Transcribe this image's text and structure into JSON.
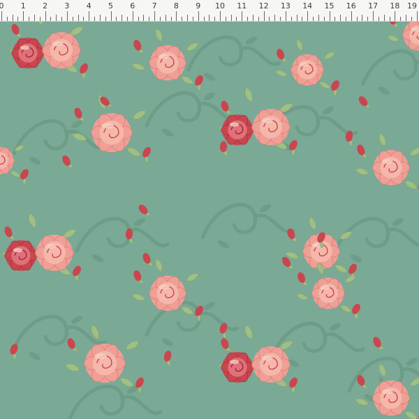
{
  "colors": {
    "fabric_background": "#7aa996",
    "swirl": "#6b9a86",
    "rose_dark": "#c9464f",
    "rose_light": "#ef9f95",
    "rose_highlight": "#f8cfc2",
    "leaf": "#9ebf86",
    "ruler_bg": "#f6f6f4"
  },
  "ruler": {
    "unit_labels": [
      "0",
      "1",
      "2",
      "3",
      "4",
      "5",
      "6",
      "7",
      "8",
      "9",
      "10",
      "11",
      "12",
      "13",
      "14",
      "15",
      "16",
      "17",
      "18",
      "19"
    ]
  },
  "pattern": {
    "motif": "rose-bouquet",
    "background_motif": "swirling-vine"
  }
}
